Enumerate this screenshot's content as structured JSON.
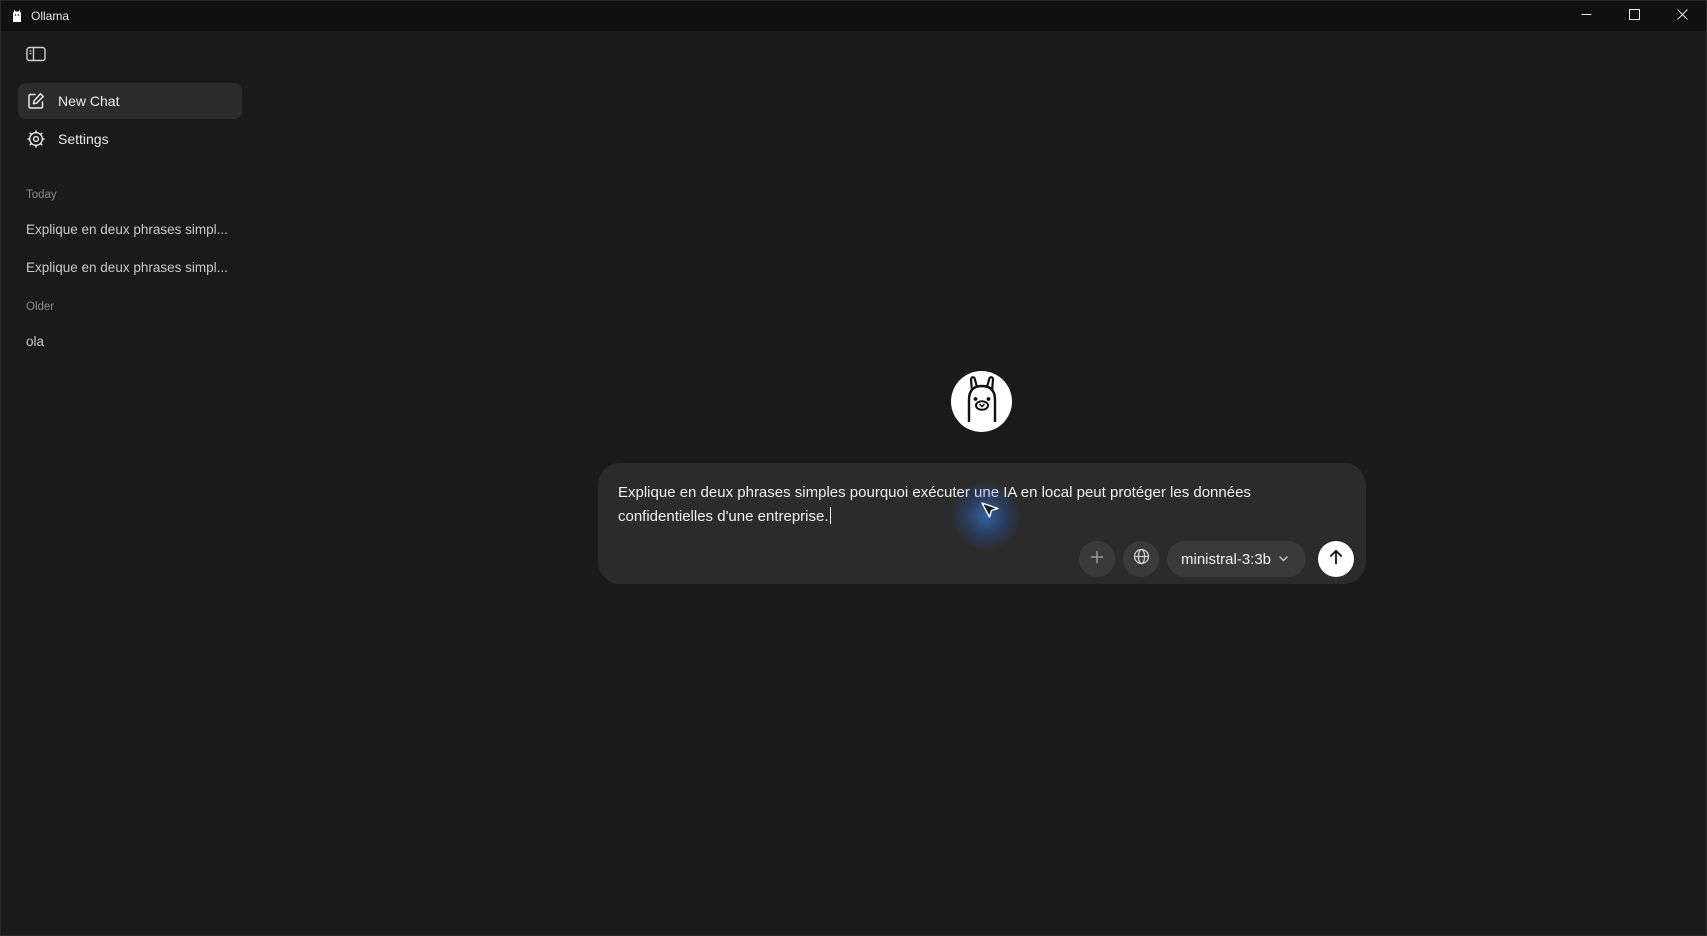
{
  "window": {
    "title": "Ollama",
    "icon": "llama-icon",
    "controls": [
      "minimize-icon",
      "maximize-icon",
      "close-icon"
    ]
  },
  "sidebar": {
    "toggle_icon": "sidebar-panel-icon",
    "nav": [
      {
        "label": "New Chat",
        "icon": "compose-icon",
        "active": true
      },
      {
        "label": "Settings",
        "icon": "gear-icon",
        "active": false
      }
    ],
    "sections": [
      {
        "label": "Today",
        "items": [
          "Explique en deux phrases simpl...",
          "Explique en deux phrases simpl..."
        ]
      },
      {
        "label": "Older",
        "items": [
          "ola"
        ]
      }
    ]
  },
  "main": {
    "avatar_icon": "llama-icon",
    "composer": {
      "text": "Explique en deux phrases simples pourquoi exécuter une IA en local peut protéger les données confidentielles d'une entreprise.",
      "attach_icon": "plus-icon",
      "web_icon": "globe-icon",
      "model": "ministral-3:3b",
      "send_icon": "arrow-up-icon"
    }
  },
  "colors": {
    "background": "#1a1a1a",
    "titlebar": "#101010",
    "composer": "#2b2b2b",
    "active_nav": "#2c2c2c",
    "cursor_glow": "#3c8cff"
  }
}
